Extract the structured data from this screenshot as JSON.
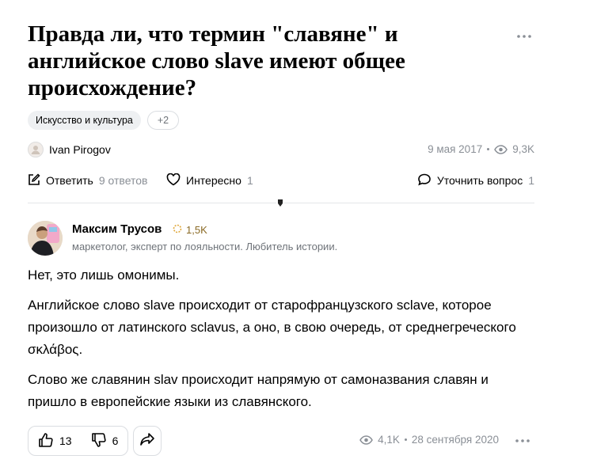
{
  "question": {
    "title": "Правда ли, что термин \"славяне\" и английское слово slave имеют общее происхождение?",
    "tags": [
      "Искусство и культура"
    ],
    "tags_more": "+2",
    "author": "Ivan Pirogov",
    "date": "9 мая 2017",
    "views": "9,3K",
    "actions": {
      "answer_label": "Ответить",
      "answer_count": "9 ответов",
      "interest_label": "Интересно",
      "interest_count": "1",
      "clarify_label": "Уточнить вопрос",
      "clarify_count": "1"
    }
  },
  "answer": {
    "author": "Максим Трусов",
    "rating": "1,5K",
    "bio": "маркетолог, эксперт по лояльности. Любитель истории.",
    "paragraphs": [
      "Нет, это лишь омонимы.",
      "Английское слово slave происходит от старофранцузского sclave, которое произошло от латинского sclavus, а оно, в свою очередь, от среднегреческого σκλάβος.",
      "Слово же славянин slav происходит напрямую от самоназвания славян и пришло в европейские языки из славянского."
    ],
    "likes": "13",
    "dislikes": "6",
    "views": "4,1K",
    "date": "28 сентября 2020"
  },
  "icons": [
    "more-icon",
    "eye-icon",
    "edit-icon",
    "heart-icon",
    "chat-icon",
    "thumb-up-icon",
    "thumb-down-icon",
    "share-icon",
    "rating-icon"
  ]
}
